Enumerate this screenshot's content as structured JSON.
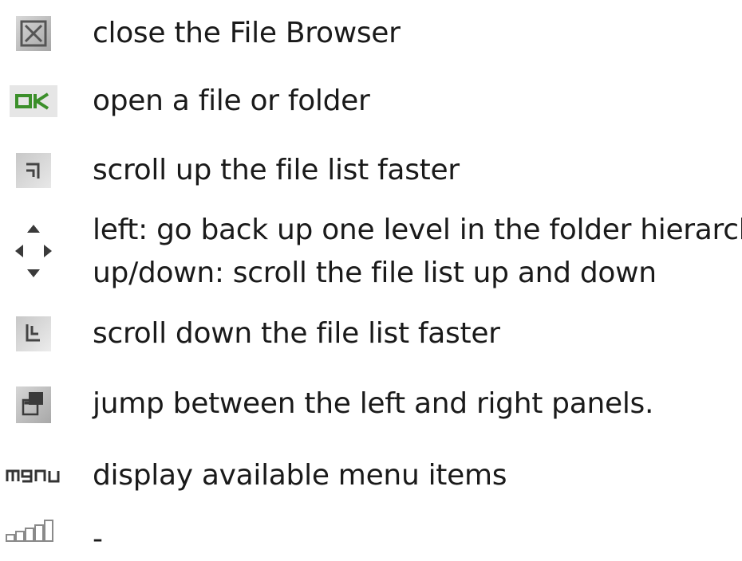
{
  "items": [
    {
      "icon": "close-icon",
      "label": "close the File Browser"
    },
    {
      "icon": "ok-icon",
      "icon_text": "OK",
      "label": "open a file or folder"
    },
    {
      "icon": "page-up-icon",
      "label": "scroll up the file list faster"
    },
    {
      "icon": "dpad-icon",
      "label": "left: go back up one level in the folder hierarchy",
      "label2": "up/down: scroll the file list up and down"
    },
    {
      "icon": "page-down-icon",
      "label": "scroll down the file list faster"
    },
    {
      "icon": "switch-panel-icon",
      "label": "jump between the left and right panels."
    },
    {
      "icon": "menu-icon",
      "icon_text": "menu",
      "label": "display available menu items"
    },
    {
      "icon": "battery-bars-icon",
      "label": "-"
    }
  ],
  "colors": {
    "ok_green": "#3b8f2a",
    "icon_gray": "#9a9a9a"
  }
}
